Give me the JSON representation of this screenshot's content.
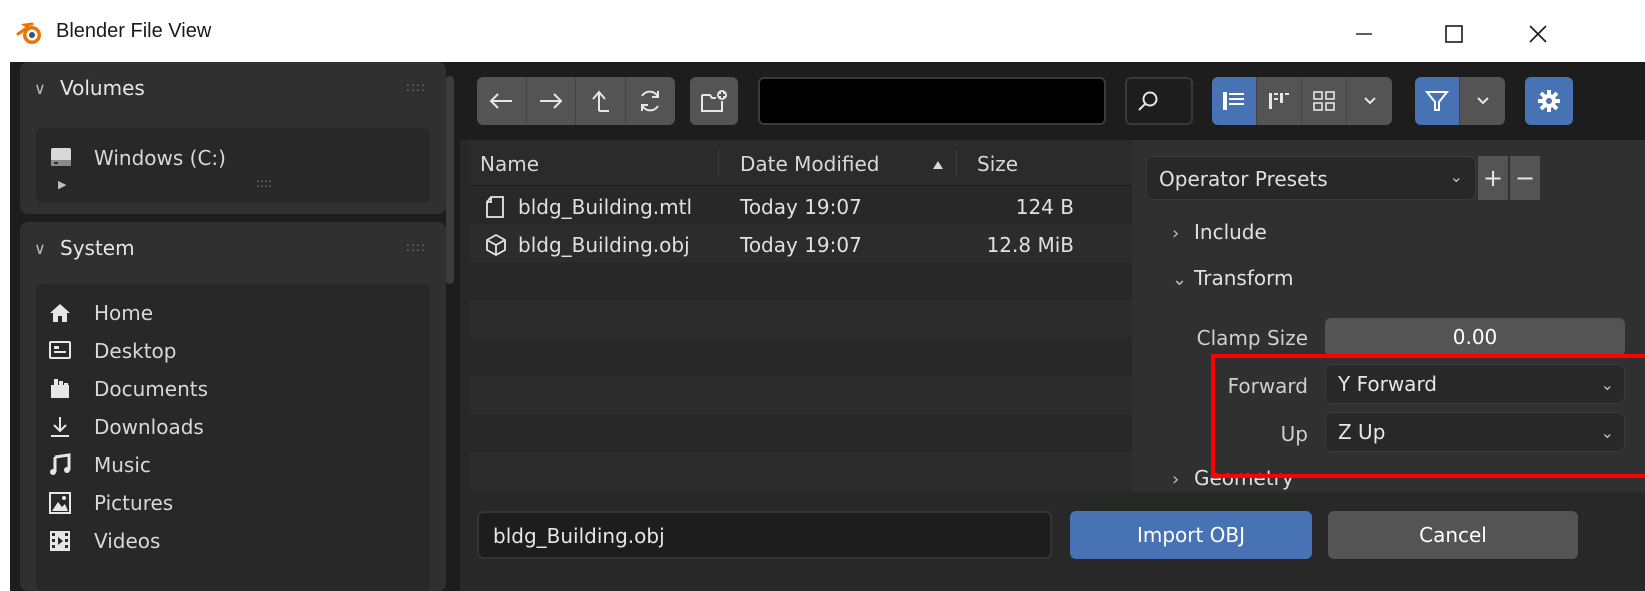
{
  "window": {
    "title": "Blender File View",
    "minimize_icon": "minimize-icon",
    "maximize_icon": "maximize-icon",
    "close_icon": "close-icon"
  },
  "sidebar": {
    "volumes": {
      "header": "Volumes",
      "items": [
        {
          "label": "Windows (C:)",
          "icon": "drive-icon"
        }
      ]
    },
    "system": {
      "header": "System",
      "items": [
        {
          "label": "Home",
          "icon": "home-icon"
        },
        {
          "label": "Desktop",
          "icon": "desktop-icon"
        },
        {
          "label": "Documents",
          "icon": "documents-icon"
        },
        {
          "label": "Downloads",
          "icon": "downloads-icon"
        },
        {
          "label": "Music",
          "icon": "music-icon"
        },
        {
          "label": "Pictures",
          "icon": "pictures-icon"
        },
        {
          "label": "Videos",
          "icon": "videos-icon"
        }
      ]
    }
  },
  "toolbar": {
    "path_value": "",
    "nav_icons": [
      "back-arrow-icon",
      "forward-arrow-icon",
      "parent-dir-icon",
      "refresh-icon"
    ],
    "view_modes": [
      "vertical-list-icon",
      "horizontal-list-icon",
      "thumbnails-icon"
    ]
  },
  "filelist": {
    "columns": {
      "name": "Name",
      "date": "Date Modified",
      "size": "Size"
    },
    "rows": [
      {
        "name": "bldg_Building.mtl",
        "date": "Today 19:07",
        "size": "124 B",
        "icon": "file-icon"
      },
      {
        "name": "bldg_Building.obj",
        "date": "Today 19:07",
        "size": "12.8 MiB",
        "icon": "mesh-icon"
      }
    ]
  },
  "footer": {
    "filename": "bldg_Building.obj",
    "import_label": "Import OBJ",
    "cancel_label": "Cancel"
  },
  "operator": {
    "presets_label": "Operator Presets",
    "sections": {
      "include": "Include",
      "transform": "Transform",
      "geometry": "Geometry"
    },
    "clamp_size": {
      "label": "Clamp Size",
      "value": "0.00"
    },
    "forward": {
      "label": "Forward",
      "value": "Y Forward"
    },
    "up": {
      "label": "Up",
      "value": "Z Up"
    }
  },
  "colors": {
    "accent": "#4772b3",
    "highlight": "#ff0000",
    "background": "#1d1d1d"
  }
}
